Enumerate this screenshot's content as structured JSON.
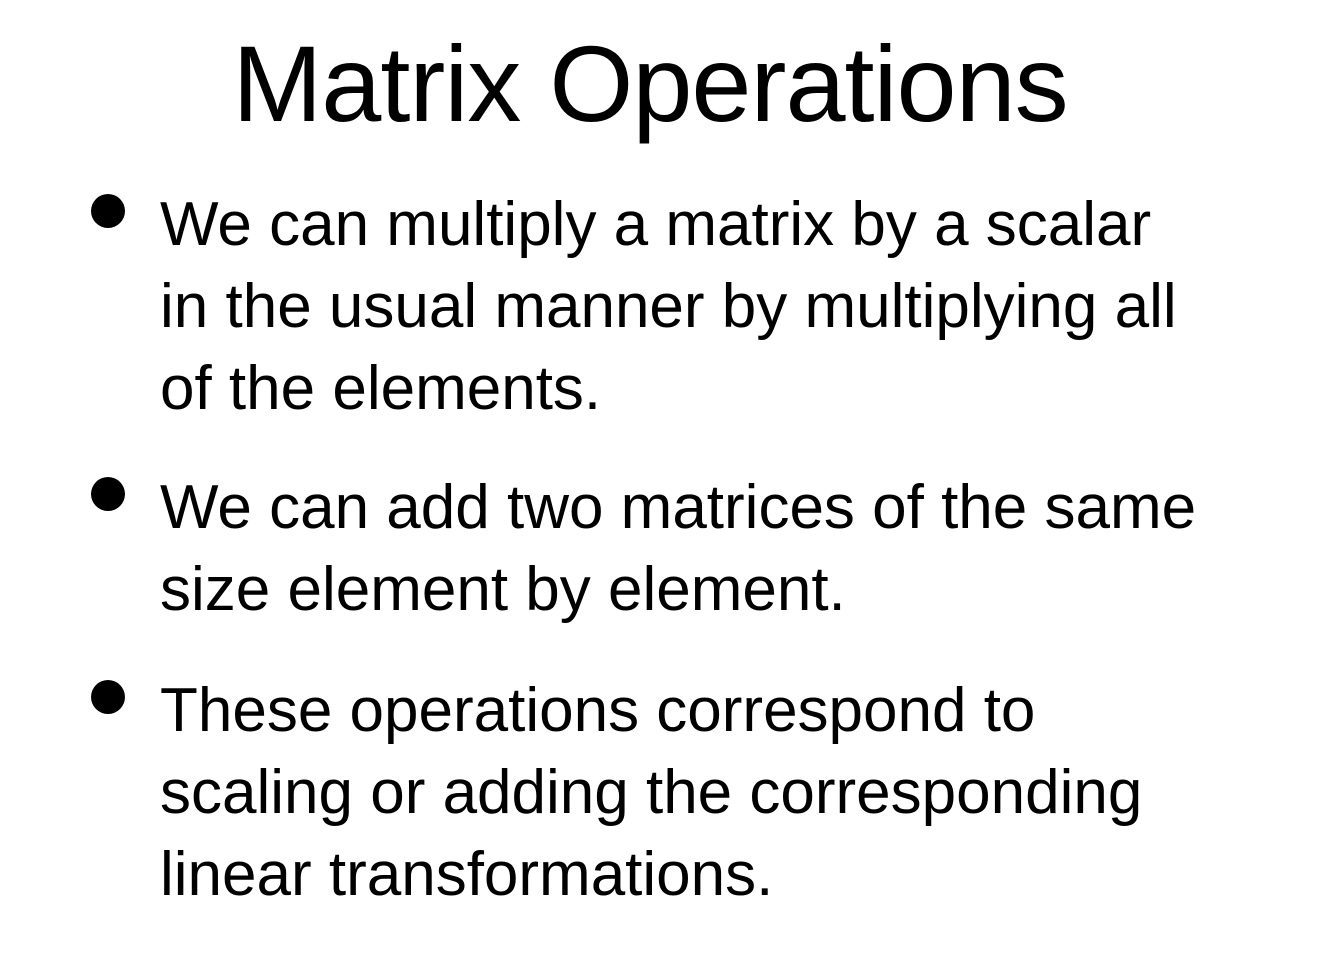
{
  "slide": {
    "title": "Matrix Operations",
    "bullets": [
      {
        "text": "We can multiply a matrix by a scalar\nin the usual manner by multiplying all\nof the elements."
      },
      {
        "text": "We can add two matrices of the same\nsize element by element."
      },
      {
        "text": "These operations correspond to\nscaling or adding the corresponding\nlinear transformations."
      }
    ]
  }
}
